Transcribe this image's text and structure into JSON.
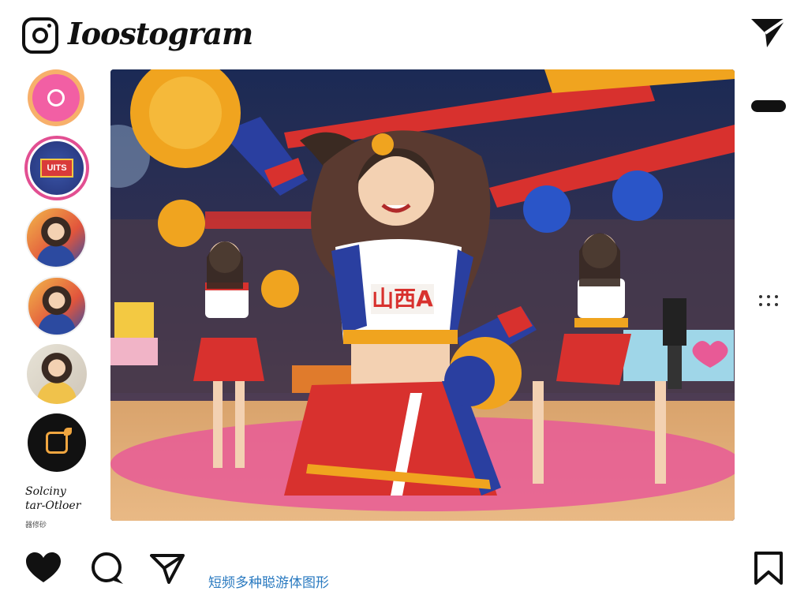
{
  "app": {
    "title": "Ioostogram"
  },
  "header": {
    "logo_icon": "camera-icon",
    "direct_icon": "paper-plane-icon"
  },
  "stories": [
    {
      "kind": "icon",
      "icon": "camera-ring-icon"
    },
    {
      "kind": "badge",
      "badge_text": "UITS"
    },
    {
      "kind": "photo"
    },
    {
      "kind": "photo"
    },
    {
      "kind": "photo"
    },
    {
      "kind": "icon",
      "icon": "pencil-square-icon"
    }
  ],
  "side_caption": {
    "line1": "Solciny",
    "line2": "tar-Otloer",
    "small": "器修砂"
  },
  "post": {
    "jersey_text": "山西A",
    "colors": {
      "red": "#d8312e",
      "blue": "#2a3fa0",
      "gold": "#f0a41f",
      "court": "#e2a56a",
      "pink_circle": "#e85a96"
    }
  },
  "actions": {
    "like_icon": "heart-icon",
    "comment_icon": "comment-icon",
    "share_icon": "share-icon",
    "save_icon": "bookmark-icon",
    "caption": "短频多种聪游体图形"
  }
}
